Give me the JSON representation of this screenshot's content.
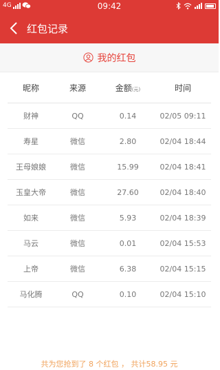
{
  "status_bar": {
    "network": "4G",
    "time": "09:42"
  },
  "nav": {
    "title": "红包记录",
    "back_icon": "chevron-left-icon"
  },
  "banner": {
    "icon": "user-circle-icon",
    "label": "我的红包"
  },
  "table": {
    "headers": {
      "nickname": "昵称",
      "source": "来源",
      "amount": "金额",
      "amount_unit": "(元)",
      "time": "时间"
    },
    "rows": [
      {
        "nickname": "财神",
        "source": "QQ",
        "amount": "0.14",
        "time": "02/05 09:11"
      },
      {
        "nickname": "寿星",
        "source": "微信",
        "amount": "2.80",
        "time": "02/04 18:44"
      },
      {
        "nickname": "王母娘娘",
        "source": "微信",
        "amount": "15.99",
        "time": "02/04 18:41"
      },
      {
        "nickname": "玉皇大帝",
        "source": "微信",
        "amount": "27.60",
        "time": "02/04 18:40"
      },
      {
        "nickname": "如来",
        "source": "微信",
        "amount": "5.93",
        "time": "02/04 18:39"
      },
      {
        "nickname": "马云",
        "source": "微信",
        "amount": "0.01",
        "time": "02/04 15:53"
      },
      {
        "nickname": "上帝",
        "source": "微信",
        "amount": "6.38",
        "time": "02/04 15:15"
      },
      {
        "nickname": "马化腾",
        "source": "QQ",
        "amount": "0.10",
        "time": "02/04 15:10"
      }
    ]
  },
  "footer": {
    "summary": "共为您抢到了 8 个红包 ， 共计58.95 元"
  },
  "colors": {
    "accent": "#dd3a35",
    "banner_text": "#e6433b",
    "footer_text": "#f0a35c"
  }
}
